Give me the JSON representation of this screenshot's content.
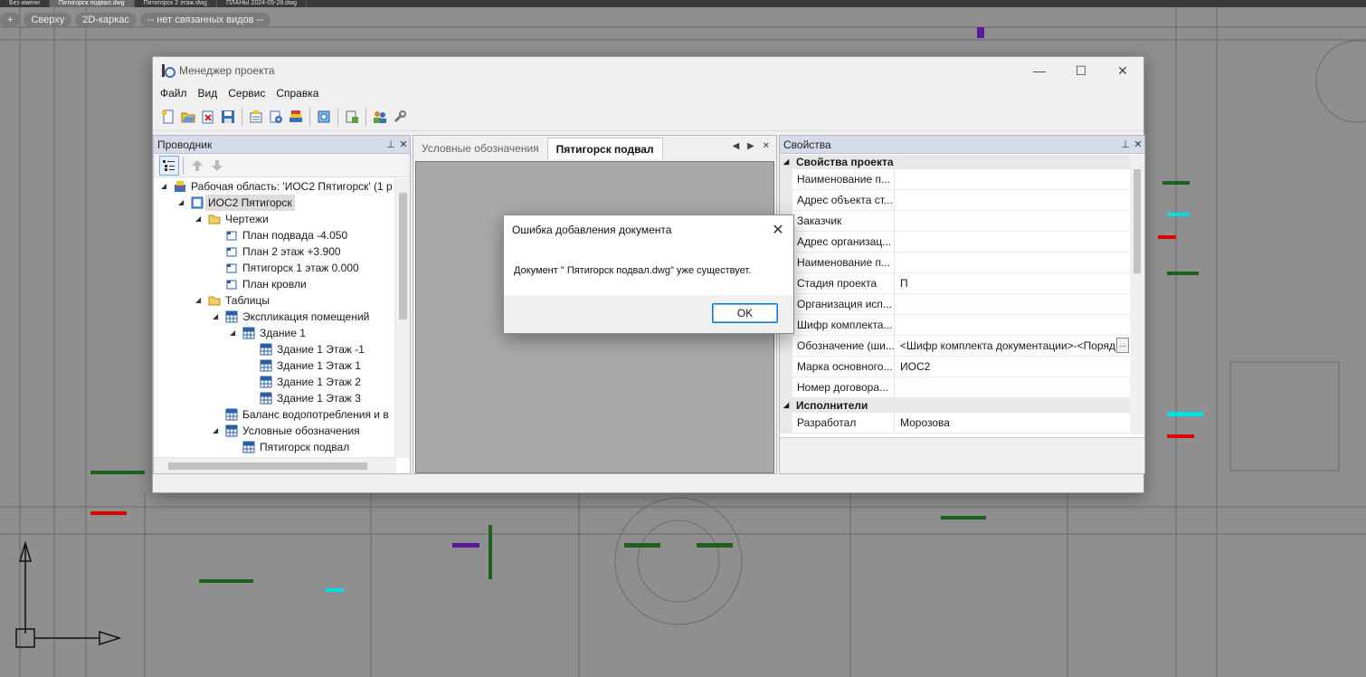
{
  "cad": {
    "doc_tabs": [
      "Без имени",
      "Пятигорск подвал.dwg",
      "Пятигорск 2 этаж.dwg",
      "ПЛАНЫ 2024-05-28.dwg"
    ],
    "viewport_controls": [
      "+",
      "Сверху",
      "2D-каркас",
      "-- нет связанных видов --"
    ]
  },
  "window": {
    "title": "Менеджер проекта",
    "controls": {
      "minimize": "—",
      "maximize": "☐",
      "close": "✕"
    },
    "menu": [
      "Файл",
      "Вид",
      "Сервис",
      "Справка"
    ]
  },
  "explorer": {
    "title": "Проводник",
    "pin": "📌",
    "close": "✕",
    "tree": [
      {
        "level": 0,
        "icon": "workspace",
        "label": "Рабочая область: 'ИОС2 Пятигорск' (1 р",
        "expanded": true
      },
      {
        "level": 1,
        "icon": "project",
        "label": "ИОС2 Пятигорск",
        "expanded": true,
        "selected": true
      },
      {
        "level": 2,
        "icon": "folder",
        "label": "Чертежи",
        "expanded": true
      },
      {
        "level": 3,
        "icon": "drawing",
        "label": "План подвада -4.050"
      },
      {
        "level": 3,
        "icon": "drawing",
        "label": "План  2 этаж +3.900"
      },
      {
        "level": 3,
        "icon": "drawing",
        "label": "Пятигорск 1 этаж  0.000"
      },
      {
        "level": 3,
        "icon": "drawing",
        "label": "План кровли"
      },
      {
        "level": 2,
        "icon": "folder",
        "label": "Таблицы",
        "expanded": true
      },
      {
        "level": 3,
        "icon": "table",
        "label": "Экспликация помещений",
        "expanded": true
      },
      {
        "level": 4,
        "icon": "table",
        "label": "Здание 1",
        "expanded": true
      },
      {
        "level": 5,
        "icon": "table",
        "label": "Здание 1 Этаж -1"
      },
      {
        "level": 5,
        "icon": "table",
        "label": "Здание 1 Этаж 1"
      },
      {
        "level": 5,
        "icon": "table",
        "label": "Здание 1 Этаж 2"
      },
      {
        "level": 5,
        "icon": "table",
        "label": "Здание 1 Этаж 3"
      },
      {
        "level": 3,
        "icon": "table",
        "label": "Баланс водопотребления и в"
      },
      {
        "level": 3,
        "icon": "table",
        "label": "Условные обозначения",
        "expanded": true
      },
      {
        "level": 4,
        "icon": "table",
        "label": "Пятигорск подвал"
      }
    ]
  },
  "center": {
    "tabs": [
      {
        "label": "Условные обозначения",
        "active": false
      },
      {
        "label": "Пятигорск подвал",
        "active": true
      }
    ],
    "tab_controls": "◀ ▶ ✕"
  },
  "properties": {
    "title": "Свойства",
    "pin": "📌",
    "close": "✕",
    "categories": [
      {
        "name": "Свойства проекта",
        "rows": [
          {
            "name": "Наименование п...",
            "value": ""
          },
          {
            "name": "Адрес объекта ст...",
            "value": ""
          },
          {
            "name": "Заказчик",
            "value": ""
          },
          {
            "name": "Адрес организац...",
            "value": ""
          },
          {
            "name": "Наименование п...",
            "value": ""
          },
          {
            "name": "Стадия проекта",
            "value": "П"
          },
          {
            "name": "Организация исп...",
            "value": ""
          },
          {
            "name": "Шифр комплекта...",
            "value": ""
          },
          {
            "name": "Обозначение (ши...",
            "value": "<Шифр комплекта документации>-<Поряд",
            "button": "..."
          },
          {
            "name": "Марка основного...",
            "value": "ИОС2"
          },
          {
            "name": "Номер договора...",
            "value": ""
          }
        ]
      },
      {
        "name": "Исполнители",
        "rows": [
          {
            "name": "Разработал",
            "value": "Морозова"
          }
        ]
      }
    ]
  },
  "dialog": {
    "title": "Ошибка добавления документа",
    "close": "✕",
    "message": "Документ \" Пятигорск подвал.dwg\"  уже существует.",
    "ok_label": "OK"
  },
  "colors": {
    "pane_header": "#d6dbe9",
    "accent": "#0078d4",
    "cad_background": "#8f8f8f"
  }
}
